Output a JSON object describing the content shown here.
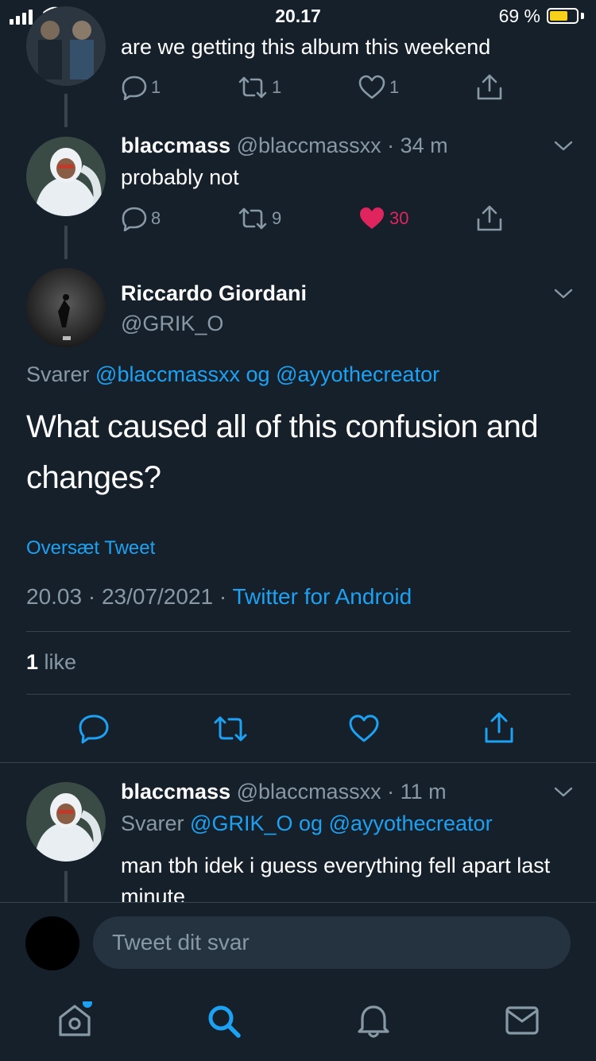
{
  "status_bar": {
    "time": "20.17",
    "battery": "69 %",
    "battery_level": 0.69
  },
  "thread": [
    {
      "text": "are we getting this album this weekend",
      "replies": "1",
      "retweets": "1",
      "likes": "1"
    },
    {
      "name": "blaccmass",
      "handle": "@blaccmassxx",
      "time": "· 34 m",
      "text": "probably not",
      "replies": "8",
      "retweets": "9",
      "likes": "30"
    }
  ],
  "main_tweet": {
    "name": "Riccardo Giordani",
    "handle": "@GRIK_O",
    "reply_prefix": "Svarer",
    "reply_to_1": "@blaccmassxx",
    "reply_and": "og",
    "reply_to_2": "@ayyothecreator",
    "text": "What caused all of this confusion and changes?",
    "translate": "Oversæt Tweet",
    "timestamp": "20.03 · 23/07/2021 ·",
    "source": "Twitter for Android",
    "like_count": "1",
    "like_label": "like"
  },
  "reply": {
    "name": "blaccmass",
    "handle": "@blaccmassxx",
    "time": "· 11 m",
    "reply_prefix": "Svarer",
    "reply_to_1": "@GRIK_O",
    "reply_and": "og",
    "reply_to_2": "@ayyothecreator",
    "text": "man tbh idek i guess everything fell apart last minute"
  },
  "composer": {
    "placeholder": "Tweet dit svar"
  },
  "colors": {
    "background": "#15202b",
    "accent": "#1da1f2",
    "like": "#e0245e",
    "muted": "#8899a6"
  },
  "tab_bar": {
    "icons": [
      "home-icon",
      "search-icon",
      "notifications-icon",
      "messages-icon"
    ]
  }
}
